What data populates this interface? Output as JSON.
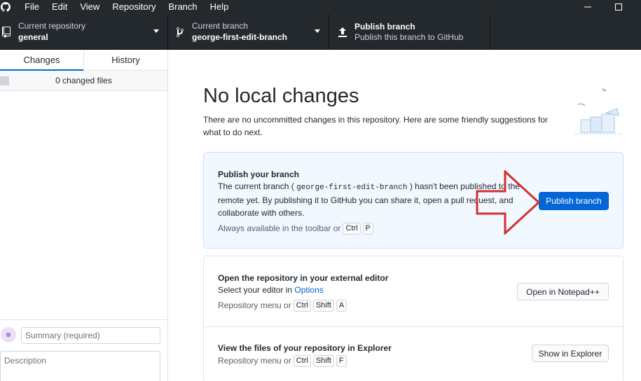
{
  "menubar": {
    "items": [
      "File",
      "Edit",
      "View",
      "Repository",
      "Branch",
      "Help"
    ]
  },
  "toolbar": {
    "repo_label": "Current repository",
    "repo_value": "general",
    "branch_label": "Current branch",
    "branch_value": "george-first-edit-branch",
    "publish_title": "Publish branch",
    "publish_subtitle": "Publish this branch to GitHub"
  },
  "sidebar": {
    "tabs": [
      "Changes",
      "History"
    ],
    "changed_files": "0 changed files",
    "summary_placeholder": "Summary (required)",
    "description_placeholder": "Description"
  },
  "main": {
    "title": "No local changes",
    "description": "There are no uncommitted changes in this repository. Here are some friendly suggestions for what to do next.",
    "publish_card": {
      "title": "Publish your branch",
      "text_before": "The current branch (",
      "branch_code": "george-first-edit-branch",
      "text_after": ") hasn't been published to the remote yet. By publishing it to GitHub you can share it, open a pull request, and collaborate with others.",
      "hint": "Always available in the toolbar or",
      "keys": [
        "Ctrl",
        "P"
      ],
      "button": "Publish branch"
    },
    "editor_card": {
      "title": "Open the repository in your external editor",
      "text": "Select your editor in",
      "link": "Options",
      "hint": "Repository menu or",
      "keys": [
        "Ctrl",
        "Shift",
        "A"
      ],
      "button": "Open in Notepad++"
    },
    "explorer_card": {
      "title": "View the files of your repository in Explorer",
      "hint": "Repository menu or",
      "keys": [
        "Ctrl",
        "Shift",
        "F"
      ],
      "button": "Show in Explorer"
    }
  },
  "colors": {
    "titlebar": "#24292e",
    "accent": "#0366d6",
    "highlight_card": "#f1f8ff",
    "annotation_arrow": "#d32f2f"
  }
}
